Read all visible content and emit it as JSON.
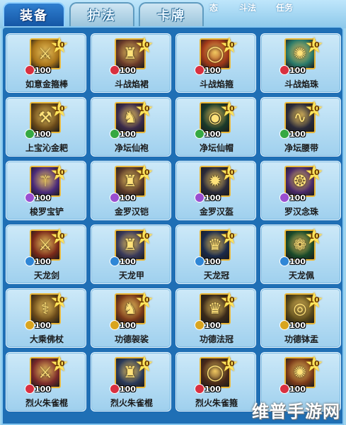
{
  "tabs": [
    {
      "label": "装备",
      "active": true
    },
    {
      "label": "护法",
      "active": false
    },
    {
      "label": "卡牌",
      "active": false
    }
  ],
  "background_tabs": [
    "态",
    "斗法",
    "任务"
  ],
  "items": [
    {
      "name": "如意金箍棒",
      "level": "10",
      "value": "100",
      "badge": "red-badge",
      "badge_color": "#d83040",
      "icon": "staff-icon",
      "icon_glyph": "⚔",
      "icon_bg": "#a8741a"
    },
    {
      "name": "斗战焰裙",
      "level": "10",
      "value": "100",
      "badge": "red-badge",
      "badge_color": "#d83040",
      "icon": "armor-icon",
      "icon_glyph": "♜",
      "icon_bg": "#6a3b2a"
    },
    {
      "name": "斗战焰箍",
      "level": "10",
      "value": "100",
      "badge": "red-badge",
      "badge_color": "#d83040",
      "icon": "headband-icon",
      "icon_glyph": "◯",
      "icon_bg": "#a23a1a"
    },
    {
      "name": "斗战焰珠",
      "level": "10",
      "value": "100",
      "badge": "red-badge",
      "badge_color": "#d83040",
      "icon": "orb-icon",
      "icon_glyph": "✺",
      "icon_bg": "#2a7a6a"
    },
    {
      "name": "上宝沁金耙",
      "level": "10",
      "value": "100",
      "badge": "green-badge",
      "badge_color": "#35a842",
      "icon": "rake-icon",
      "icon_glyph": "⚒",
      "icon_bg": "#6a4a1a"
    },
    {
      "name": "净坛仙袍",
      "level": "10",
      "value": "100",
      "badge": "green-badge",
      "badge_color": "#35a842",
      "icon": "robe-icon",
      "icon_glyph": "♞",
      "icon_bg": "#3a2a4a"
    },
    {
      "name": "净坛仙帽",
      "level": "10",
      "value": "100",
      "badge": "green-badge",
      "badge_color": "#35a842",
      "icon": "hat-icon",
      "icon_glyph": "◉",
      "icon_bg": "#1a3a2a"
    },
    {
      "name": "净坛腰带",
      "level": "10",
      "value": "100",
      "badge": "green-badge",
      "badge_color": "#35a842",
      "icon": "belt-icon",
      "icon_glyph": "∿",
      "icon_bg": "#2a2a3a"
    },
    {
      "name": "梭罗宝铲",
      "level": "10",
      "value": "100",
      "badge": "purple-badge",
      "badge_color": "#9a4ed0",
      "icon": "spade-icon",
      "icon_glyph": "⚚",
      "icon_bg": "#4a2a7a"
    },
    {
      "name": "金罗汉铠",
      "level": "10",
      "value": "100",
      "badge": "purple-badge",
      "badge_color": "#9a4ed0",
      "icon": "armor-icon",
      "icon_glyph": "♜",
      "icon_bg": "#5a3a2a"
    },
    {
      "name": "金罗汉盔",
      "level": "10",
      "value": "100",
      "badge": "purple-badge",
      "badge_color": "#9a4ed0",
      "icon": "helmet-icon",
      "icon_glyph": "✹",
      "icon_bg": "#2a2a3a"
    },
    {
      "name": "罗汉念珠",
      "level": "10",
      "value": "100",
      "badge": "purple-badge",
      "badge_color": "#9a4ed0",
      "icon": "beads-icon",
      "icon_glyph": "❂",
      "icon_bg": "#4a2a6a"
    },
    {
      "name": "天龙剑",
      "level": "10",
      "value": "100",
      "badge": "blue-badge",
      "badge_color": "#2f86d6",
      "icon": "sword-icon",
      "icon_glyph": "⚔",
      "icon_bg": "#7a2a1a"
    },
    {
      "name": "天龙甲",
      "level": "10",
      "value": "100",
      "badge": "blue-badge",
      "badge_color": "#2f86d6",
      "icon": "armor-icon",
      "icon_glyph": "♜",
      "icon_bg": "#3a3a5a"
    },
    {
      "name": "天龙冠",
      "level": "10",
      "value": "100",
      "badge": "blue-badge",
      "badge_color": "#2f86d6",
      "icon": "crown-icon",
      "icon_glyph": "♛",
      "icon_bg": "#1a2a4a"
    },
    {
      "name": "天龙佩",
      "level": "10",
      "value": "100",
      "badge": "blue-badge",
      "badge_color": "#2f86d6",
      "icon": "jade-icon",
      "icon_glyph": "❁",
      "icon_bg": "#1a4a2a"
    },
    {
      "name": "大乘佛杖",
      "level": "10",
      "value": "100",
      "badge": "gold-badge",
      "badge_color": "#d9a520",
      "icon": "staff-icon",
      "icon_glyph": "⚕",
      "icon_bg": "#6a4a1a"
    },
    {
      "name": "功德袈裟",
      "level": "10",
      "value": "100",
      "badge": "gold-badge",
      "badge_color": "#d9a520",
      "icon": "cassock-icon",
      "icon_glyph": "♞",
      "icon_bg": "#7a3a1a"
    },
    {
      "name": "功德法冠",
      "level": "10",
      "value": "100",
      "badge": "gold-badge",
      "badge_color": "#d9a520",
      "icon": "crown-icon",
      "icon_glyph": "♛",
      "icon_bg": "#3a2a1a"
    },
    {
      "name": "功德钵盂",
      "level": "10",
      "value": "100",
      "badge": "gold-badge",
      "badge_color": "#d9a520",
      "icon": "bowl-icon",
      "icon_glyph": "◎",
      "icon_bg": "#5a4a1a"
    },
    {
      "name": "烈火朱雀棍",
      "level": "10",
      "value": "100",
      "badge": "red-badge",
      "badge_color": "#d83040",
      "icon": "staff-icon",
      "icon_glyph": "⚔",
      "icon_bg": "#7a2a2a"
    },
    {
      "name": "烈火朱雀棍",
      "level": "10",
      "value": "100",
      "badge": "red-badge",
      "badge_color": "#d83040",
      "icon": "armor-icon",
      "icon_glyph": "♜",
      "icon_bg": "#2a3a5a"
    },
    {
      "name": "烈火朱雀箍",
      "level": "10",
      "value": "100",
      "badge": "red-badge",
      "badge_color": "#d83040",
      "icon": "headband-icon",
      "icon_glyph": "◯",
      "icon_bg": "#4a2a1a"
    },
    {
      "name": "",
      "level": "10",
      "value": "100",
      "badge": "red-badge",
      "badge_color": "#d83040",
      "icon": "orb-icon",
      "icon_glyph": "✺",
      "icon_bg": "#7a3a1a"
    }
  ],
  "watermark": "维普手游网"
}
